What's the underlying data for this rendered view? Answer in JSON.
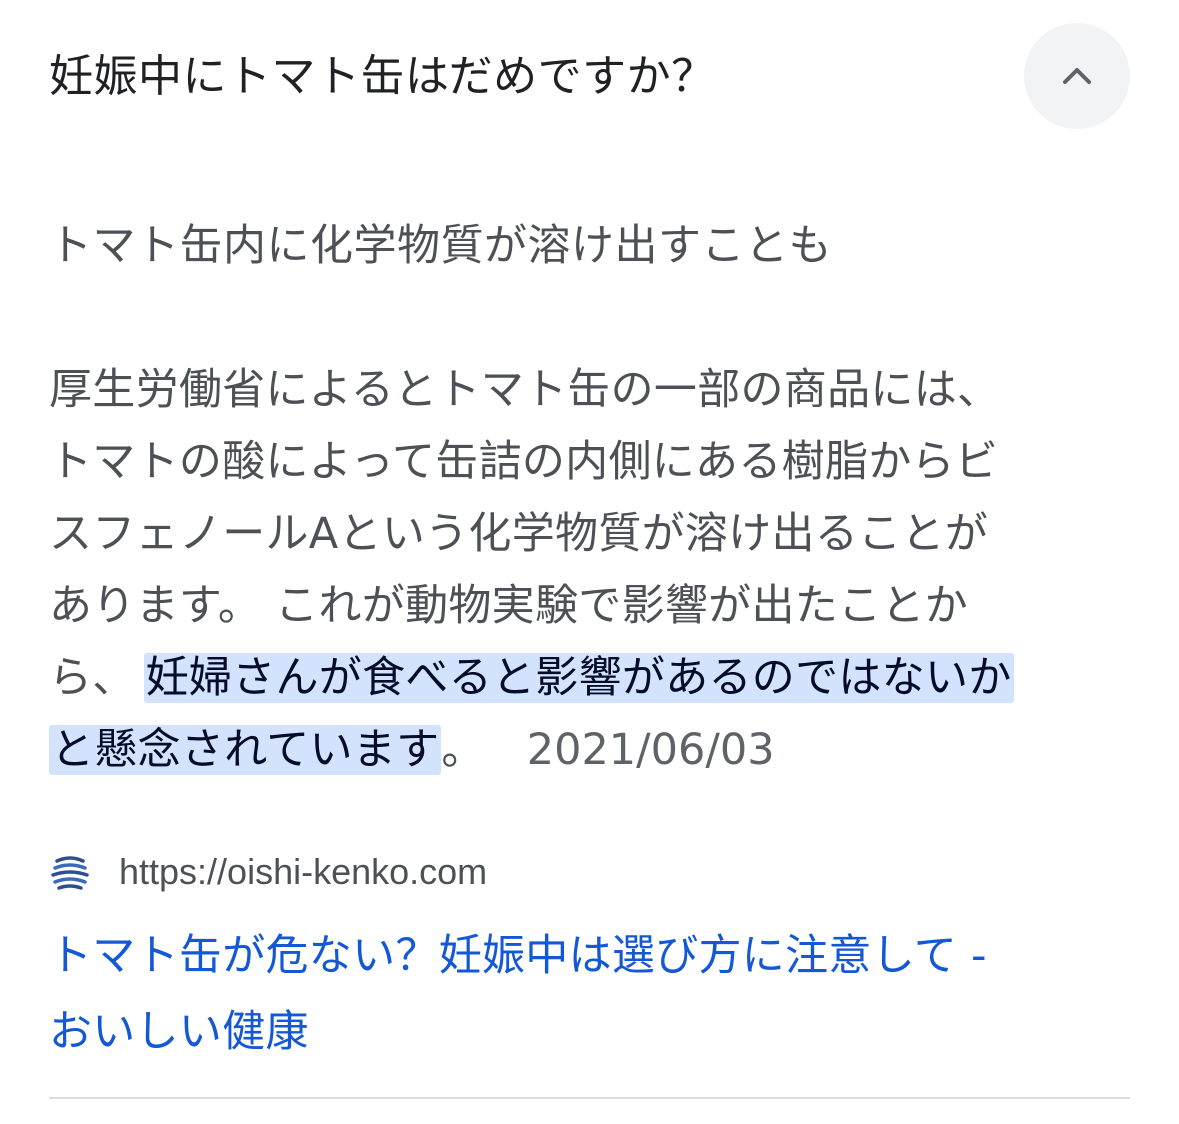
{
  "question": {
    "title": "妊娠中にトマト缶はだめですか？",
    "toggle_icon": "chevron-up-icon"
  },
  "answer": {
    "heading": "トマト缶内に化学物質が溶け出すことも",
    "lines": [
      "厚生労働省によるとトマト缶の一部の商品には、",
      "トマトの酸によって缶詰の内側にある樹脂からビ",
      "スフェノールAという化学物質が溶け出ることが",
      "あります。 これが動物実験で影響が出たことか"
    ],
    "line5_prefix": "ら、",
    "highlight_part1": "妊婦さんが食べると影響があるのではないか",
    "highlight_part2": "と懸念されています",
    "line6_suffix": "。",
    "date": "2021/06/03"
  },
  "source": {
    "favicon_icon": "site-logo-icon",
    "url": "https://oishi-kenko.com",
    "title_line1": "トマト缶が危ない？妊娠中は選び方に注意して -",
    "title_line2": "おいしい健康"
  },
  "colors": {
    "title_text": "#202124",
    "body_text": "#4d5156",
    "highlight_bg": "#d3e3fd",
    "link": "#1558d6",
    "toggle_bg": "#f1f3f4",
    "divider": "#dadce0"
  }
}
